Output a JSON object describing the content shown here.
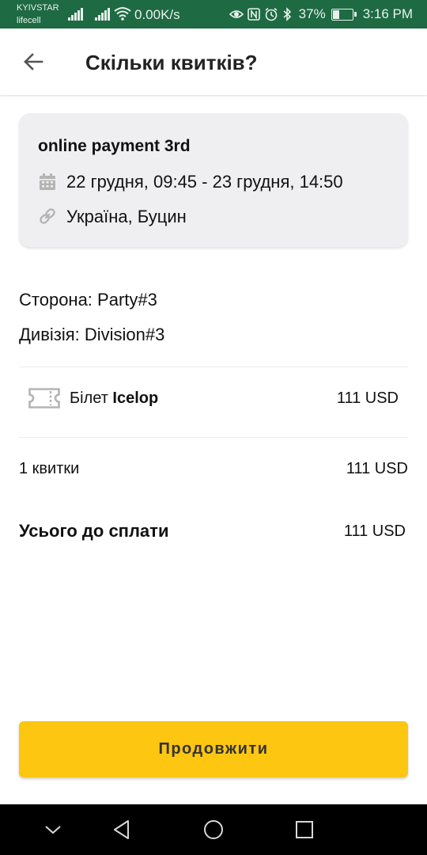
{
  "status_bar": {
    "carrier_primary": "KYIVSTAR",
    "carrier_secondary": "lifecell",
    "net_speed": "0.00K/s",
    "battery_percent": "37%",
    "battery_level": 0.37,
    "time": "3:16 PM",
    "icons": [
      "signal-icon",
      "signal-icon",
      "wifi-icon",
      "eye-icon",
      "nfc-icon",
      "alarm-icon",
      "bluetooth-icon",
      "battery-icon"
    ],
    "background_color": "#1e6a43"
  },
  "header": {
    "title": "Скільки квитків?",
    "back_icon": "arrow-left-icon"
  },
  "event": {
    "name": "online payment 3rd",
    "date_range": "22 грудня, 09:45 - 23 грудня, 14:50",
    "location": "Україна, Буцин",
    "date_icon": "calendar-icon",
    "location_icon": "link-icon"
  },
  "details": {
    "side": "Сторона: Party#3",
    "division": "Дивізія: Division#3"
  },
  "ticket": {
    "prefix": "Білет",
    "name": "Icelop",
    "price": "111 USD",
    "icon": "ticket-icon"
  },
  "summary": {
    "count_label": "1 квитки",
    "count_price": "111 USD",
    "total_label": "Усього до сплати",
    "total_price": "111 USD"
  },
  "actions": {
    "continue_label": "Продовжити",
    "accent_color": "#fcc611"
  },
  "nav_bar": {
    "icons": [
      "chevron-down-icon",
      "back-triangle-icon",
      "home-circle-icon",
      "recents-square-icon"
    ]
  }
}
